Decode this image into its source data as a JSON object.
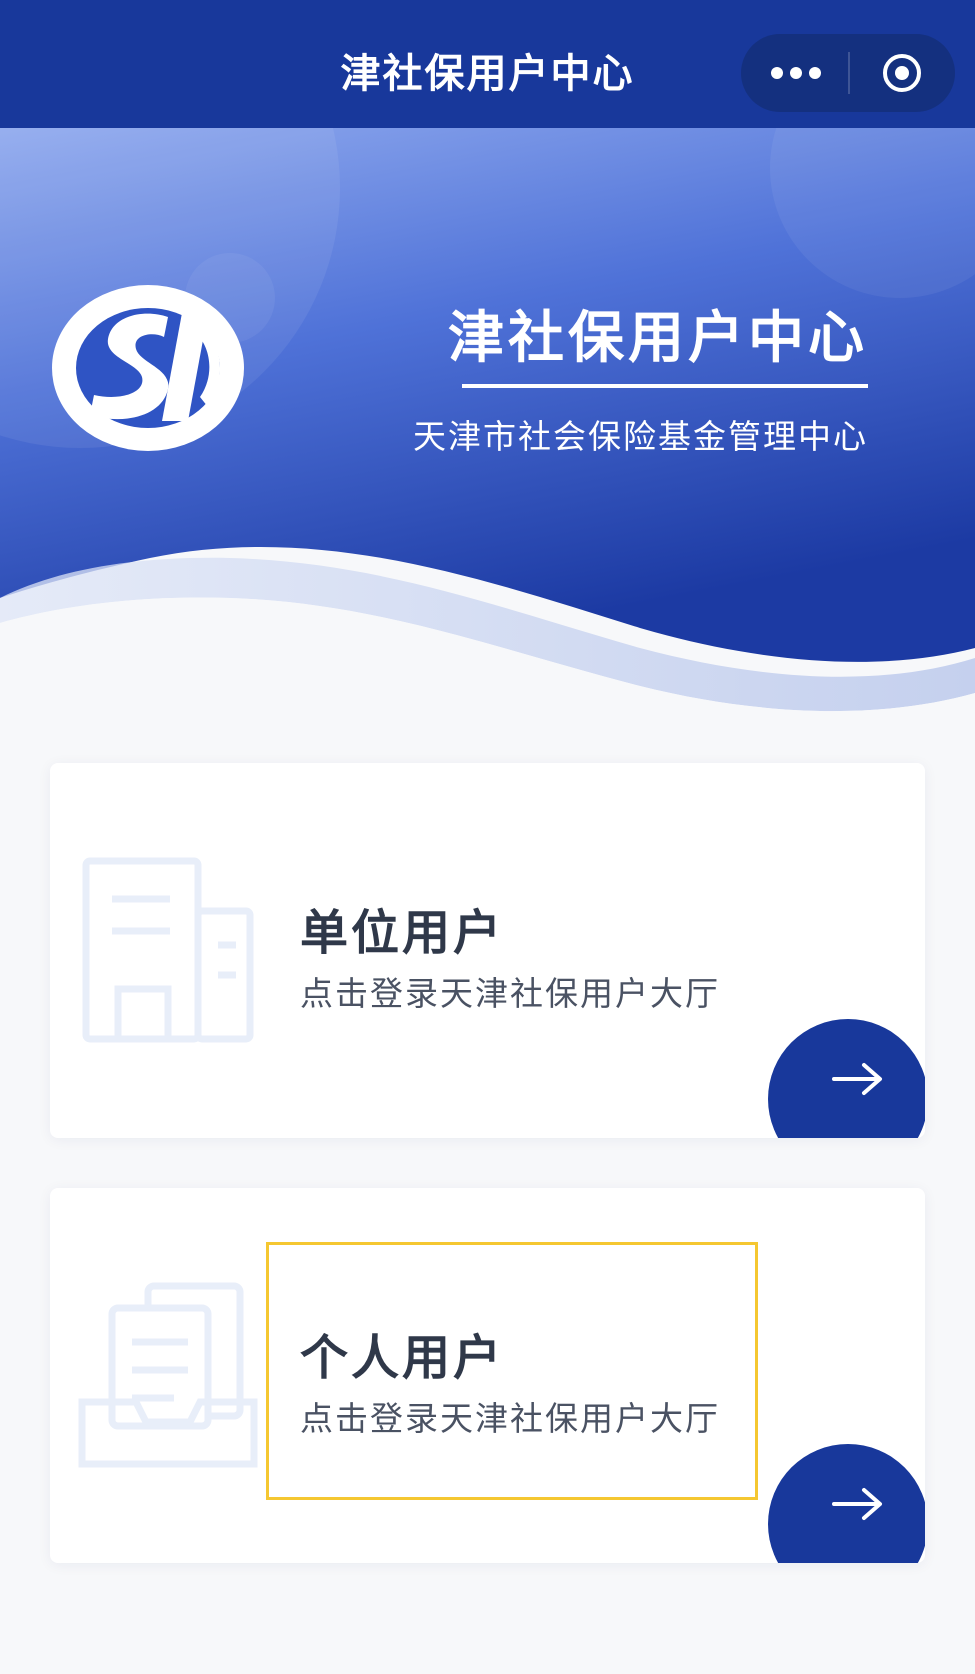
{
  "navbar": {
    "title": "津社保用户中心",
    "menu_icon": "more-dots-icon",
    "close_icon": "target-circle-icon"
  },
  "hero": {
    "logo_icon": "si-social-insurance-logo",
    "title": "津社保用户中心",
    "subtitle": "天津市社会保险基金管理中心"
  },
  "cards": [
    {
      "title": "单位用户",
      "subtitle": "点击登录天津社保用户大厅",
      "icon": "office-building-icon",
      "action_icon": "arrow-right-icon"
    },
    {
      "title": "个人用户",
      "subtitle": "点击登录天津社保用户大厅",
      "icon": "document-tray-icon",
      "action_icon": "arrow-right-icon"
    }
  ],
  "colors": {
    "primary": "#18389b",
    "highlight": "#f5c731",
    "background": "#f7f8fa"
  }
}
